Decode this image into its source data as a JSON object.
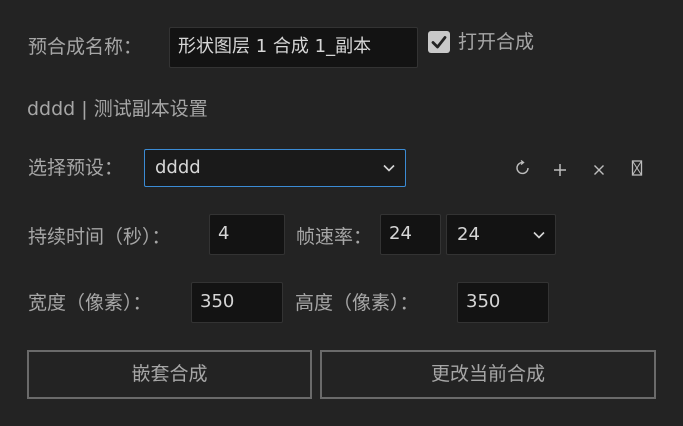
{
  "composition": {
    "name_label": "预合成名称：",
    "name_value": "形状图层 1 合成 1_副本",
    "open_label": "打开合成",
    "open_checked": true
  },
  "preset_info": {
    "text": "dddd | 测试副本设置"
  },
  "preset": {
    "label": "选择预设：",
    "selected": "dddd"
  },
  "toolbar": {
    "icons": [
      "refresh-icon",
      "add-icon",
      "close-icon",
      "delete-icon"
    ]
  },
  "timing": {
    "duration_label": "持续时间（秒）：",
    "duration_value": "4",
    "fps_label": "帧速率：",
    "fps_value": "24",
    "fps_selected": "24"
  },
  "size": {
    "width_label": "宽度（像素）：",
    "width_value": "350",
    "height_label": "高度（像素）：",
    "height_value": "350"
  },
  "buttons": {
    "nest_label": "嵌套合成",
    "change_label": "更改当前合成"
  },
  "colors": {
    "background": "#232323",
    "field_bg": "#131313",
    "focus_border": "#3b8bd4",
    "text": "#a6a6a6"
  }
}
